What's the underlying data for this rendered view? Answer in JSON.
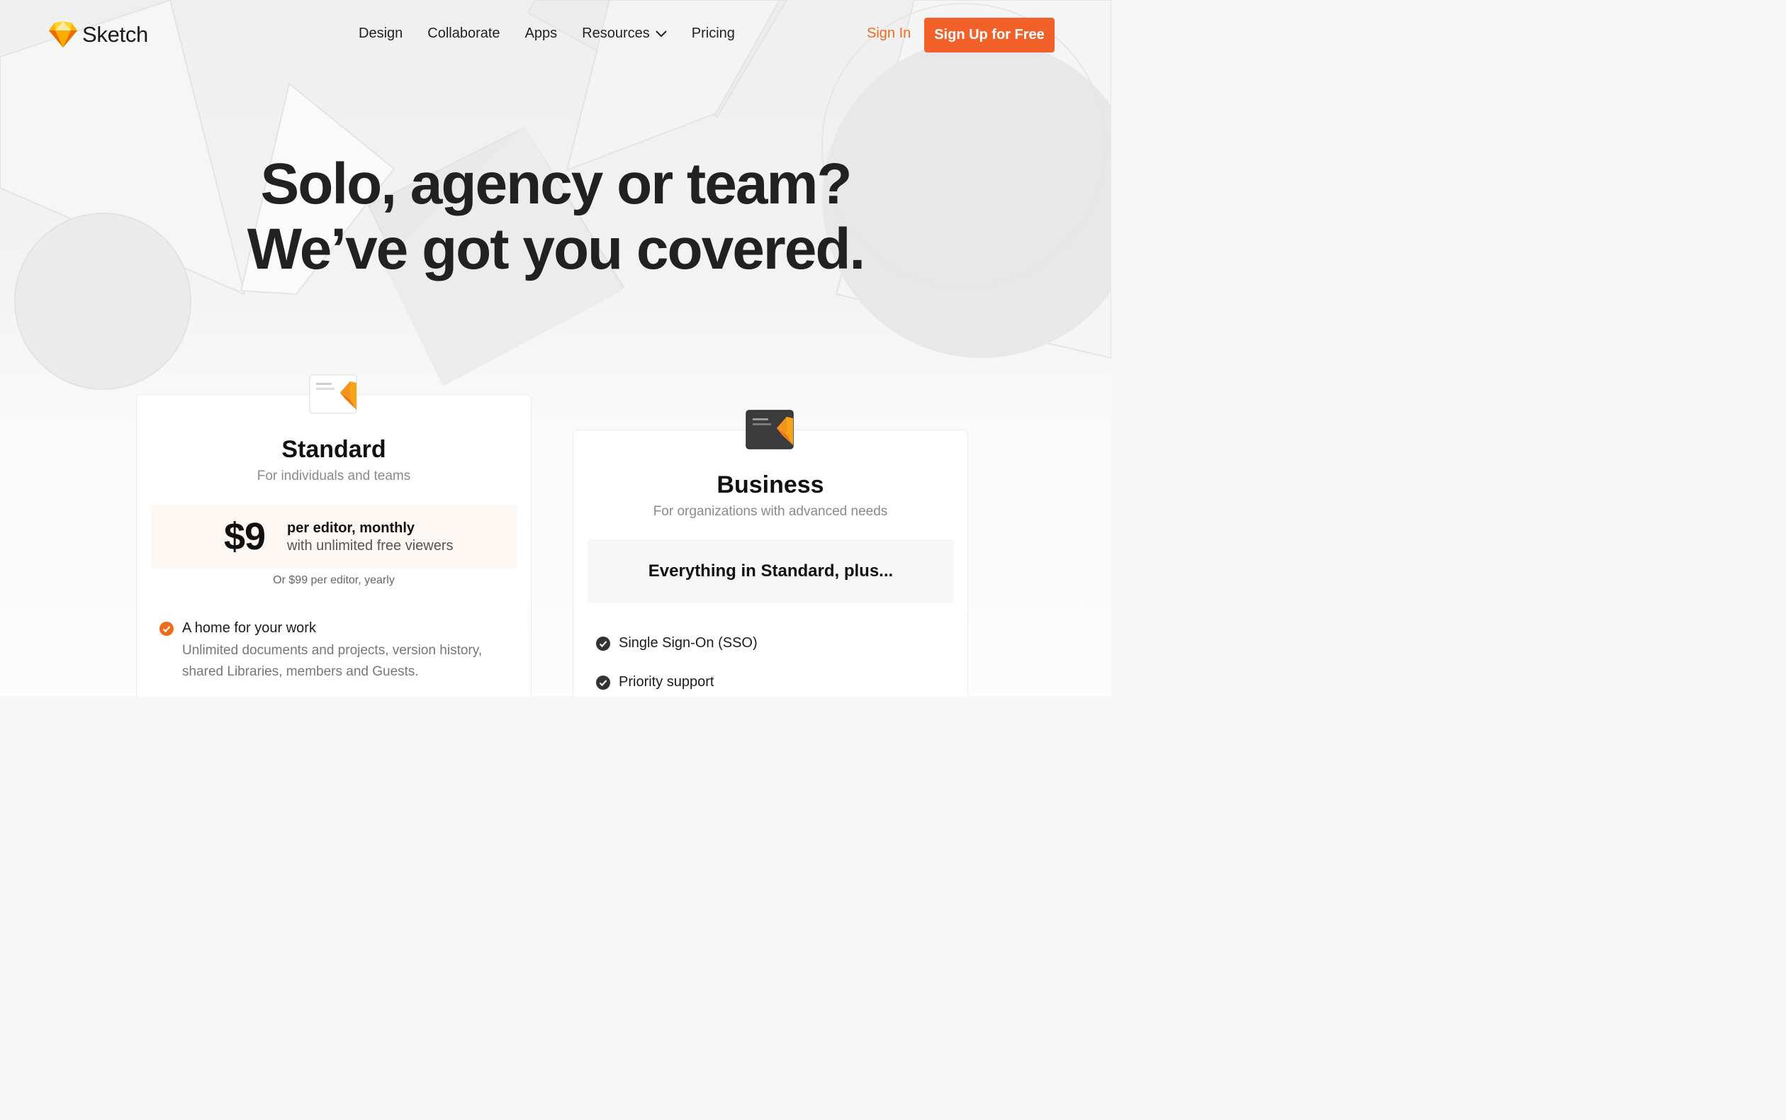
{
  "header": {
    "logo_text": "Sketch",
    "nav": [
      "Design",
      "Collaborate",
      "Apps",
      "Resources",
      "Pricing"
    ],
    "sign_in": "Sign In",
    "sign_up": "Sign Up for Free"
  },
  "hero": {
    "line1": "Solo, agency or team?",
    "line2": "We’ve got you covered."
  },
  "plans": {
    "standard": {
      "name": "Standard",
      "subtitle": "For individuals and teams",
      "price": "$9",
      "price_line1": "per editor, monthly",
      "price_line2": "with unlimited free viewers",
      "yearly": "Or $99 per editor, yearly",
      "features": [
        {
          "title": "A home for your work",
          "description": "Unlimited documents and projects, version history, shared Libraries, members and Guests."
        }
      ]
    },
    "business": {
      "name": "Business",
      "subtitle": "For organizations with advanced needs",
      "plus": "Everything in Standard, plus...",
      "features": [
        "Single Sign-On (SSO)",
        "Priority support"
      ]
    }
  },
  "colors": {
    "accent": "#f2612a",
    "sign_in": "#f26b1d",
    "check_standard": "#f26b1d",
    "check_business": "#333333"
  }
}
